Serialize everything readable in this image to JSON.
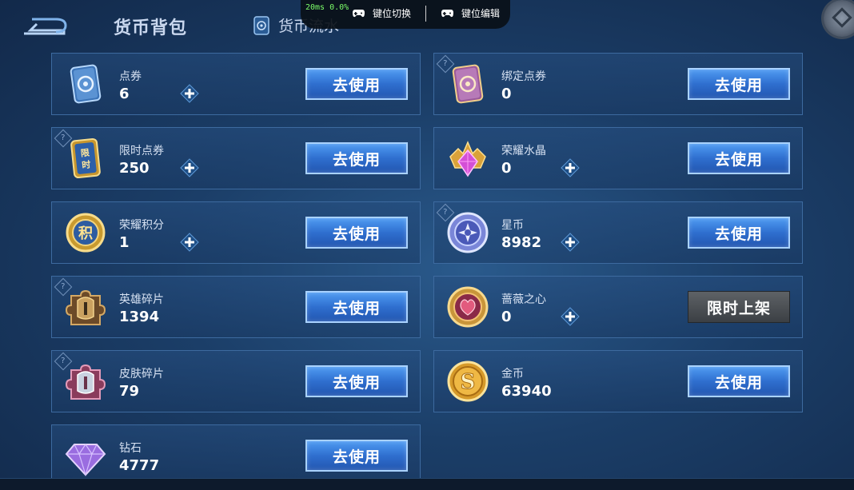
{
  "header": {
    "title": "货币背包",
    "tab_flow": "货币流水"
  },
  "overlay": {
    "ping": "20ms",
    "loss": "0.0%",
    "key_switch": "键位切换",
    "key_edit": "键位编辑"
  },
  "colors": {
    "button_blue": "#3a82e0",
    "button_gray": "#4a4e53",
    "card_border": "#3d6a9f",
    "ping_green": "#7dff6a"
  },
  "currencies": {
    "dianquan": {
      "name": "点券",
      "amount": "6",
      "button": "去使用",
      "icon": "voucher-card-icon"
    },
    "bangding": {
      "name": "绑定点券",
      "amount": "0",
      "button": "去使用",
      "icon": "bound-voucher-card-icon"
    },
    "xianshi": {
      "name": "限时点券",
      "amount": "250",
      "button": "去使用",
      "icon": "limited-voucher-icon",
      "icon_text": "限时"
    },
    "shuijing": {
      "name": "荣耀水晶",
      "amount": "0",
      "button": "去使用",
      "icon": "glory-crystal-icon"
    },
    "jifen": {
      "name": "荣耀积分",
      "amount": "1",
      "button": "去使用",
      "icon": "glory-points-coin-icon",
      "icon_text": "积"
    },
    "xingbi": {
      "name": "星币",
      "amount": "8982",
      "button": "去使用",
      "icon": "star-coin-icon"
    },
    "yingxiong": {
      "name": "英雄碎片",
      "amount": "1394",
      "button": "去使用",
      "icon": "hero-shard-icon"
    },
    "qiangwei": {
      "name": "蔷薇之心",
      "amount": "0",
      "button": "限时上架",
      "icon": "rose-heart-icon"
    },
    "pifu": {
      "name": "皮肤碎片",
      "amount": "79",
      "button": "去使用",
      "icon": "skin-shard-icon"
    },
    "jinbi": {
      "name": "金币",
      "amount": "63940",
      "button": "去使用",
      "icon": "gold-coin-icon",
      "icon_text": "S"
    },
    "zuanshi": {
      "name": "钻石",
      "amount": "4777",
      "button": "去使用",
      "icon": "diamond-icon"
    }
  }
}
